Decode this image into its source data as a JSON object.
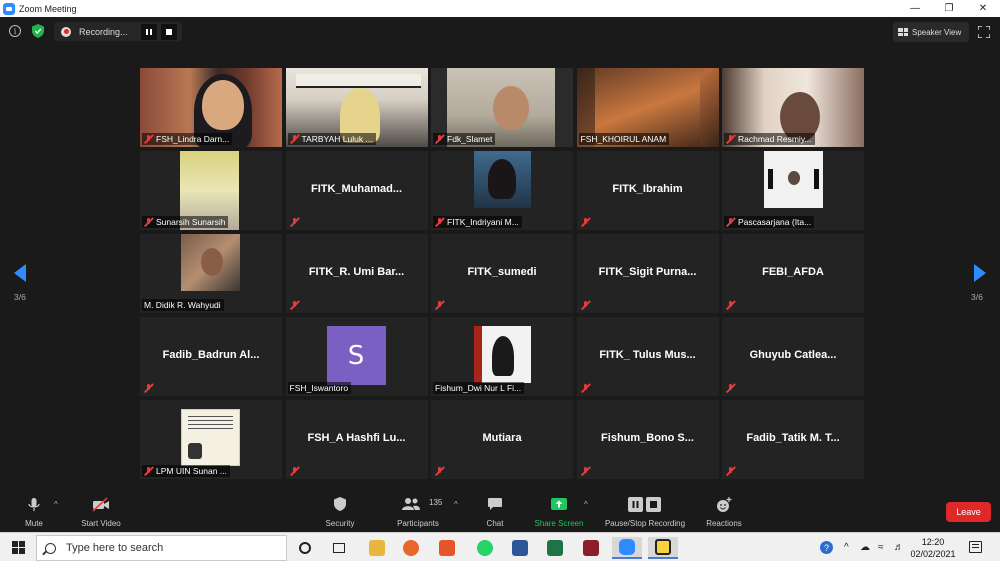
{
  "window": {
    "title": "Zoom Meeting",
    "controls": [
      "minimize",
      "maximize",
      "close"
    ]
  },
  "topbar": {
    "recording_label": "Recording...",
    "speaker_view_label": "Speaker View"
  },
  "participants": [
    {
      "name": "FSH_Lindra Darn...",
      "kind": "video"
    },
    {
      "name": "TARBYAH Luluk ...",
      "kind": "video"
    },
    {
      "name": "Fdk_Slamet",
      "kind": "video"
    },
    {
      "name": "FSH_KHOIRUL ANAM",
      "kind": "video"
    },
    {
      "name": "Rachmad Resmiy...",
      "kind": "video"
    },
    {
      "name": "Sunarsih Sunarsih",
      "kind": "photo"
    },
    {
      "name": "FITK_Muhamad...",
      "kind": "name"
    },
    {
      "name": "FITK_Indriyani M...",
      "kind": "photo"
    },
    {
      "name": "FITK_Ibrahim",
      "kind": "name"
    },
    {
      "name": "Pascasarjana (Ita...",
      "kind": "photo"
    },
    {
      "name": "M. Didik R. Wahyudi",
      "kind": "photo"
    },
    {
      "name": "FITK_R. Umi Bar...",
      "kind": "name"
    },
    {
      "name": "FITK_sumedi",
      "kind": "name"
    },
    {
      "name": "FITK_Sigit  Purna...",
      "kind": "name"
    },
    {
      "name": "FEBI_AFDA",
      "kind": "name"
    },
    {
      "name": "Fadib_Badrun  Al...",
      "kind": "name"
    },
    {
      "name": "FSH_Iswantoro",
      "kind": "avatar",
      "initial": "S"
    },
    {
      "name": "Fishum_Dwi Nur L Fi...",
      "kind": "photo"
    },
    {
      "name": "FITK_ Tulus Mus...",
      "kind": "name"
    },
    {
      "name": "Ghuyub  Catlea...",
      "kind": "name"
    },
    {
      "name": "LPM UIN Sunan ...",
      "kind": "photo"
    },
    {
      "name": "FSH_A  Hashfi Lu...",
      "kind": "name"
    },
    {
      "name": "Mutiara",
      "kind": "name"
    },
    {
      "name": "Fishum_Bono  S...",
      "kind": "name"
    },
    {
      "name": "Fadib_Tatik M. T...",
      "kind": "name"
    }
  ],
  "pagination": {
    "left_label": "3/6",
    "right_label": "3/6"
  },
  "toolbar": {
    "mute": "Mute",
    "start_video": "Start Video",
    "security": "Security",
    "participants": "Participants",
    "participants_count": "135",
    "chat": "Chat",
    "share_screen": "Share Screen",
    "pause_stop_recording": "Pause/Stop Recording",
    "reactions": "Reactions",
    "leave": "Leave"
  },
  "taskbar": {
    "search_placeholder": "Type here to search",
    "time": "12:20",
    "date": "02/02/2021"
  },
  "colors": {
    "accent": "#2D8CFF",
    "leave": "#E02828",
    "share": "#22C55E",
    "mic_off": "#E63B3B"
  }
}
